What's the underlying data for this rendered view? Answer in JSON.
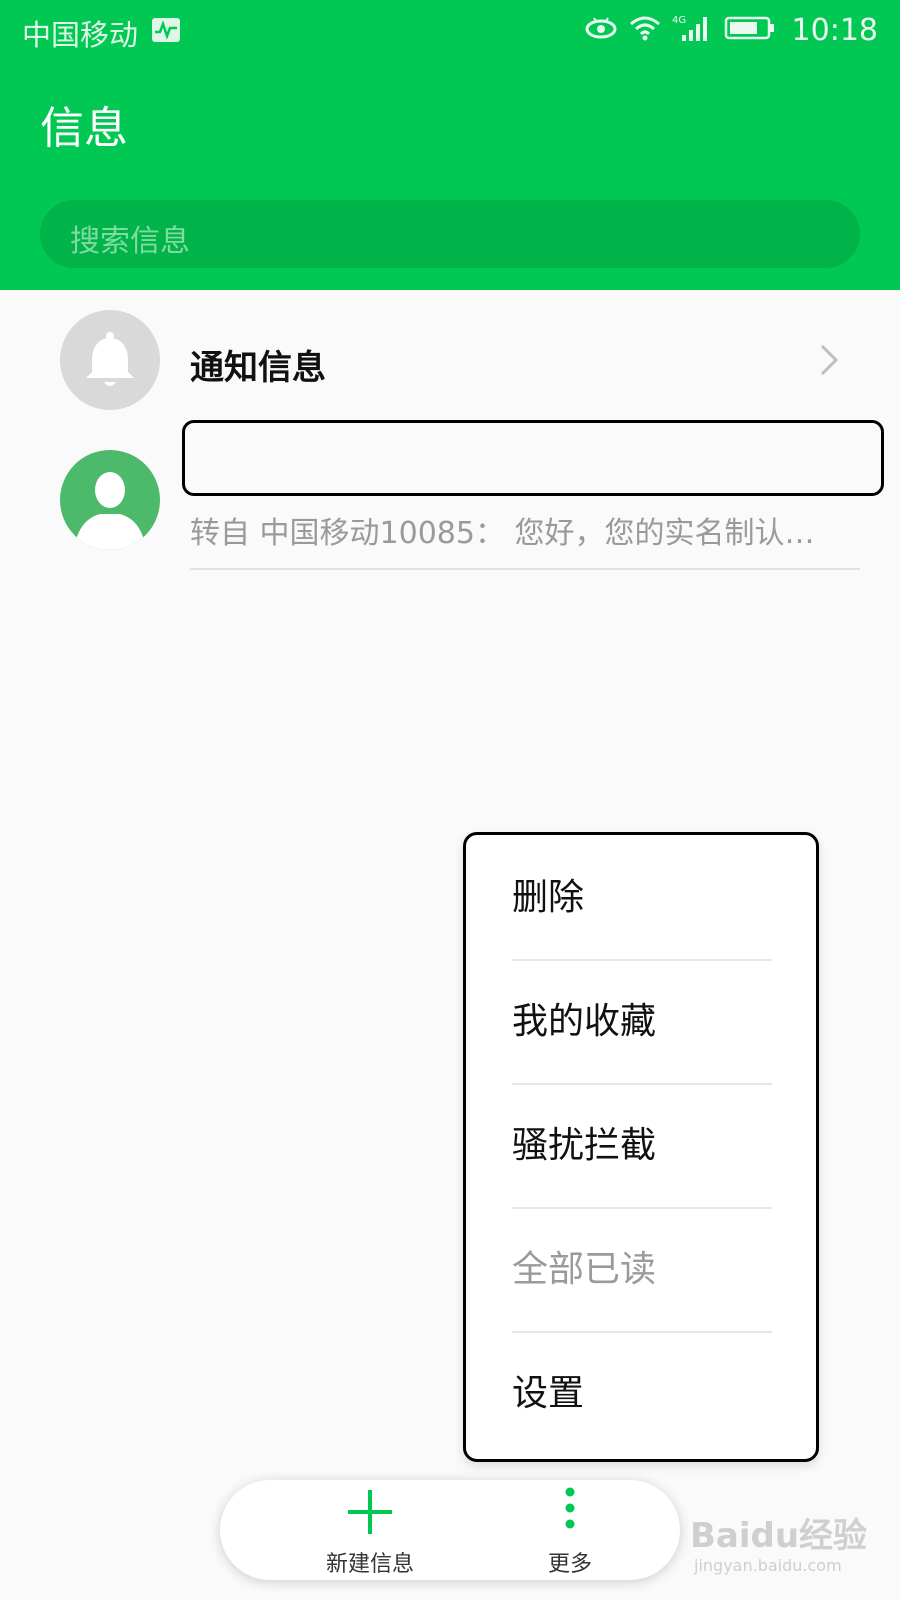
{
  "status_bar": {
    "carrier": "中国移动",
    "network_label": "4G",
    "time": "10:18",
    "icons": [
      "activity-icon",
      "eye-icon",
      "wifi-icon",
      "signal-icon",
      "battery-icon"
    ]
  },
  "header": {
    "title": "信息",
    "search_placeholder": "搜索信息"
  },
  "conversations": [
    {
      "title": "通知信息",
      "avatar": "bell-icon"
    },
    {
      "title": "",
      "preview": "转自 中国移动10085： 您好，您的实名制认…",
      "avatar": "person-icon"
    }
  ],
  "menu": {
    "items": [
      {
        "label": "删除",
        "enabled": true
      },
      {
        "label": "我的收藏",
        "enabled": true
      },
      {
        "label": "骚扰拦截",
        "enabled": true
      },
      {
        "label": "全部已读",
        "enabled": false
      },
      {
        "label": "设置",
        "enabled": true
      }
    ]
  },
  "bottom_bar": {
    "new_label": "新建信息",
    "more_label": "更多"
  },
  "watermark": {
    "main": "Baidu经验",
    "sub": "jingyan.baidu.com"
  },
  "colors": {
    "brand": "#00c853",
    "search_bg": "#00b44a",
    "avatar_green": "#4cb96b"
  }
}
